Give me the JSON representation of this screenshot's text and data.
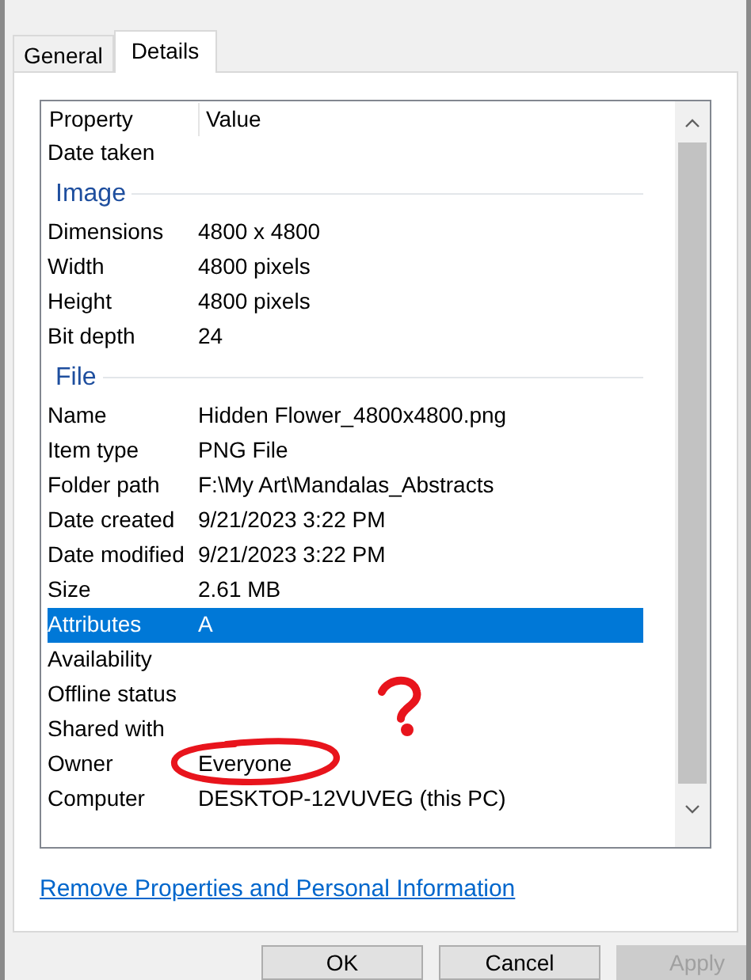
{
  "tabs": [
    {
      "label": "General",
      "selected": false
    },
    {
      "label": "Details",
      "selected": true
    }
  ],
  "columns": [
    "Property",
    "Value"
  ],
  "items": [
    {
      "kind": "row",
      "property": "Date taken",
      "value": "",
      "selected": false
    },
    {
      "kind": "heading",
      "label": "Image"
    },
    {
      "kind": "row",
      "property": "Dimensions",
      "value": "4800 x 4800",
      "selected": false
    },
    {
      "kind": "row",
      "property": "Width",
      "value": "4800 pixels",
      "selected": false
    },
    {
      "kind": "row",
      "property": "Height",
      "value": "4800 pixels",
      "selected": false
    },
    {
      "kind": "row",
      "property": "Bit depth",
      "value": "24",
      "selected": false
    },
    {
      "kind": "heading",
      "label": "File"
    },
    {
      "kind": "row",
      "property": "Name",
      "value": "Hidden Flower_4800x4800.png",
      "selected": false
    },
    {
      "kind": "row",
      "property": "Item type",
      "value": "PNG File",
      "selected": false
    },
    {
      "kind": "row",
      "property": "Folder path",
      "value": "F:\\My Art\\Mandalas_Abstracts",
      "selected": false
    },
    {
      "kind": "row",
      "property": "Date created",
      "value": "9/21/2023 3:22 PM",
      "selected": false
    },
    {
      "kind": "row",
      "property": "Date modified",
      "value": "9/21/2023 3:22 PM",
      "selected": false
    },
    {
      "kind": "row",
      "property": "Size",
      "value": "2.61 MB",
      "selected": false
    },
    {
      "kind": "row",
      "property": "Attributes",
      "value": "A",
      "selected": true
    },
    {
      "kind": "row",
      "property": "Availability",
      "value": "",
      "selected": false
    },
    {
      "kind": "row",
      "property": "Offline status",
      "value": "",
      "selected": false
    },
    {
      "kind": "row",
      "property": "Shared with",
      "value": "",
      "selected": false
    },
    {
      "kind": "row",
      "property": "Owner",
      "value": "Everyone",
      "selected": false
    },
    {
      "kind": "row",
      "property": "Computer",
      "value": "DESKTOP-12VUVEG (this PC)",
      "selected": false
    }
  ],
  "link": "Remove Properties and Personal Information",
  "buttons": [
    {
      "label": "OK",
      "disabled": false
    },
    {
      "label": "Cancel",
      "disabled": false
    },
    {
      "label": "Apply",
      "disabled": true
    }
  ]
}
